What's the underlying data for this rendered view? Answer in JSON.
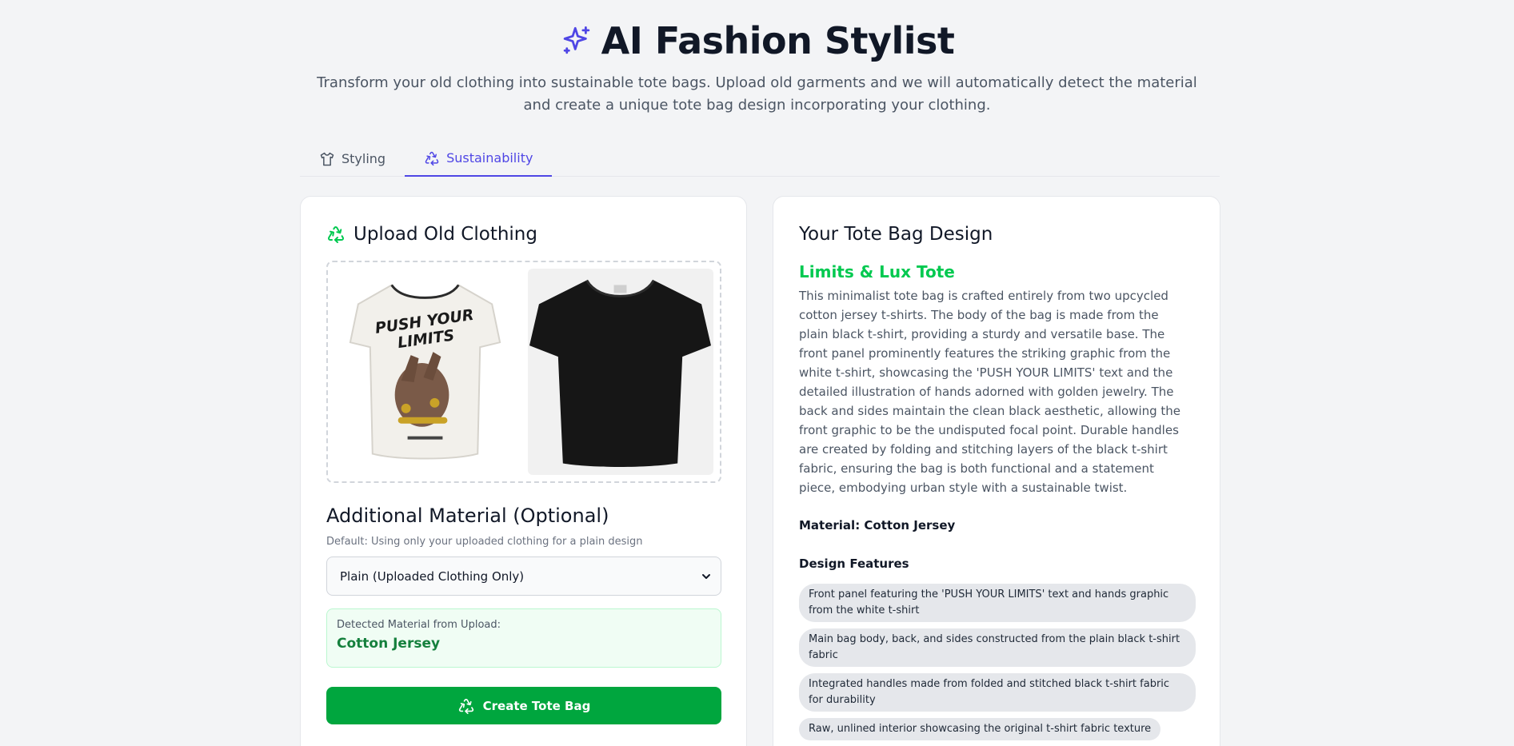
{
  "header": {
    "title": "AI Fashion Stylist",
    "subtitle": "Transform your old clothing into sustainable tote bags. Upload old garments and we will automatically detect the material and create a unique tote bag design incorporating your clothing."
  },
  "tabs": [
    {
      "label": "Styling",
      "icon": "shirt-icon",
      "active": false
    },
    {
      "label": "Sustainability",
      "icon": "recycle-icon",
      "active": true
    }
  ],
  "upload": {
    "title": "Upload Old Clothing",
    "images": [
      {
        "name": "uploaded-white-tshirt",
        "print_text": "PUSH YOUR LIMITS"
      },
      {
        "name": "uploaded-black-tshirt"
      }
    ],
    "additional_title": "Additional Material (Optional)",
    "additional_hint": "Default: Using only your uploaded clothing for a plain design",
    "select_value": "Plain (Uploaded Clothing Only)",
    "detected_label": "Detected Material from Upload:",
    "detected_value": "Cotton Jersey",
    "create_label": "Create Tote Bag"
  },
  "design": {
    "title": "Your Tote Bag Design",
    "name": "Limits & Lux Tote",
    "description": "This minimalist tote bag is crafted entirely from two upcycled cotton jersey t-shirts. The body of the bag is made from the plain black t-shirt, providing a sturdy and versatile base. The front panel prominently features the striking graphic from the white t-shirt, showcasing the 'PUSH YOUR LIMITS' text and the detailed illustration of hands adorned with golden jewelry. The back and sides maintain the clean black aesthetic, allowing the front graphic to be the undisputed focal point. Durable handles are created by folding and stitching layers of the black t-shirt fabric, ensuring the bag is both functional and a statement piece, embodying urban style with a sustainable twist.",
    "material": "Material: Cotton Jersey",
    "features_title": "Design Features",
    "features": [
      "Front panel featuring the 'PUSH YOUR LIMITS' text and hands graphic from the white t-shirt",
      "Main bag body, back, and sides constructed from the plain black t-shirt fabric",
      "Integrated handles made from folded and stitched black t-shirt fabric for durability",
      "Raw, unlined interior showcasing the original t-shirt fabric texture"
    ]
  },
  "colors": {
    "accent": "#4f46e5",
    "green": "#00a63e",
    "green_text": "#00c950"
  }
}
